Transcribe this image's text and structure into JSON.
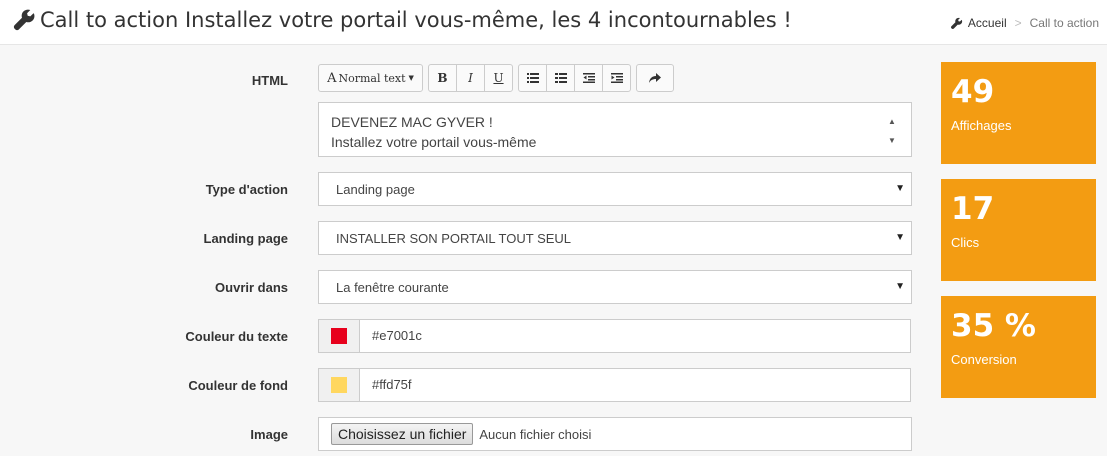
{
  "header": {
    "title": "Call to action Installez votre portail vous-même, les 4 incontournables !",
    "icon": "wrench-icon"
  },
  "breadcrumb": {
    "home": "Accueil",
    "current": "Call to action"
  },
  "form": {
    "html_label": "HTML",
    "toolbar": {
      "format_label": "Normal text",
      "bold": "B",
      "italic": "I",
      "underline": "U",
      "icons": [
        "unordered-list-icon",
        "ordered-list-icon",
        "outdent-icon",
        "indent-icon",
        "share-icon"
      ]
    },
    "editor_lines": [
      "DEVENEZ MAC GYVER !",
      "Installez votre portail vous-même"
    ],
    "type_action": {
      "label": "Type d'action",
      "value": "Landing page"
    },
    "landing_page": {
      "label": "Landing page",
      "value": "INSTALLER SON PORTAIL TOUT SEUL"
    },
    "ouvrir_dans": {
      "label": "Ouvrir dans",
      "value": "La fenêtre courante"
    },
    "couleur_texte": {
      "label": "Couleur du texte",
      "value": "#e7001c",
      "swatch": "#e7001c"
    },
    "couleur_fond": {
      "label": "Couleur de fond",
      "value": "#ffd75f",
      "swatch": "#ffd75f"
    },
    "image": {
      "label": "Image",
      "button": "Choisissez un fichier",
      "status": "Aucun fichier choisi"
    }
  },
  "stats": [
    {
      "value": "49",
      "label": "Affichages"
    },
    {
      "value": "17",
      "label": "Clics"
    },
    {
      "value": "35 %",
      "label": "Conversion"
    }
  ],
  "colors": {
    "stat_bg": "#f39c12"
  }
}
